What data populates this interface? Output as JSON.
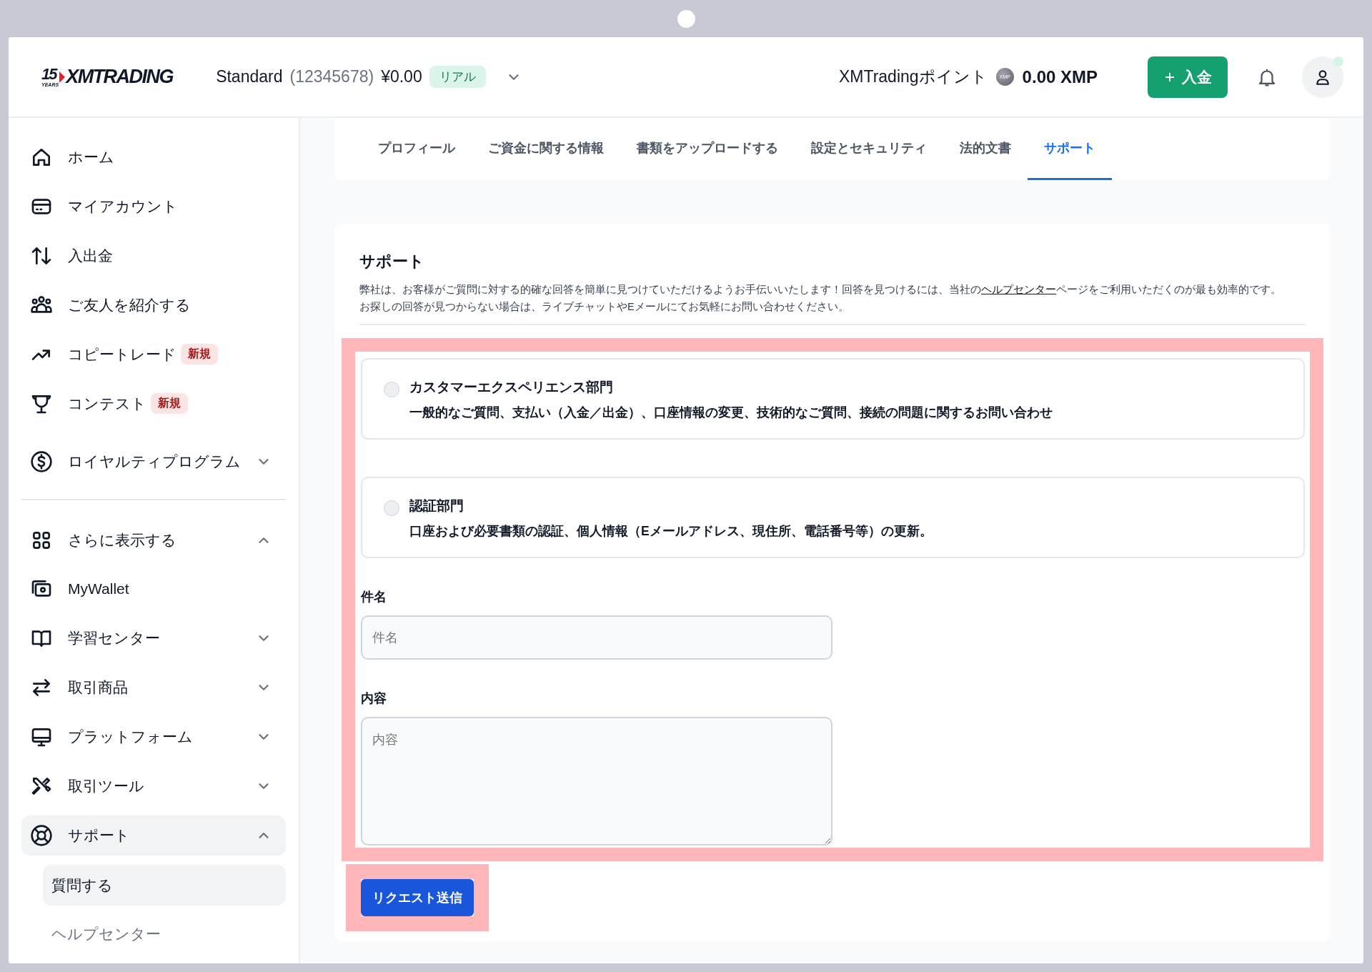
{
  "header": {
    "logo": {
      "years_number": "15",
      "years_word": "YEARS",
      "brand": "XMTRADING"
    },
    "account": {
      "type": "Standard",
      "number": "(12345678)",
      "balance": "¥0.00",
      "badge": "リアル"
    },
    "points": {
      "label": "XMTradingポイント",
      "coin_label": "XMP",
      "value": "0.00 XMP"
    },
    "deposit_button": "入金",
    "avatar": {
      "online": true
    }
  },
  "sidebar": {
    "primary": [
      {
        "label": "ホーム",
        "selected": false
      },
      {
        "label": "マイアカウント",
        "selected": false
      },
      {
        "label": "入出金",
        "selected": false
      },
      {
        "label": "ご友人を紹介する",
        "selected": false
      },
      {
        "label": "コピートレード",
        "badge": "新規",
        "selected": false
      },
      {
        "label": "コンテスト",
        "badge": "新規",
        "selected": false
      },
      {
        "label": "ロイヤルティプログラム",
        "expanded": false,
        "selected": false
      }
    ],
    "secondary": [
      {
        "label": "さらに表示する",
        "expanded": true,
        "selected": false
      },
      {
        "label": "MyWallet",
        "selected": false
      },
      {
        "label": "学習センター",
        "expanded": false,
        "selected": false
      },
      {
        "label": "取引商品",
        "expanded": false,
        "selected": false
      },
      {
        "label": "プラットフォーム",
        "expanded": false,
        "selected": false
      },
      {
        "label": "取引ツール",
        "expanded": false,
        "selected": false
      },
      {
        "label": "サポート",
        "expanded": true,
        "selected": true,
        "children": [
          {
            "label": "質問する",
            "selected": true
          },
          {
            "label": "ヘルプセンター",
            "selected": false
          }
        ]
      }
    ]
  },
  "tabs": [
    {
      "label": "プロフィール",
      "selected": false
    },
    {
      "label": "ご資金に関する情報",
      "selected": false
    },
    {
      "label": "書類をアップロードする",
      "selected": false
    },
    {
      "label": "設定とセキュリティ",
      "selected": false
    },
    {
      "label": "法的文書",
      "selected": false
    },
    {
      "label": "サポート",
      "selected": true
    }
  ],
  "support": {
    "title": "サポート",
    "description": {
      "before_link": "弊社は、お客様がご質問に対する的確な回答を簡単に見つけていただけるようお手伝いいたします！回答を見つけるには、当社の",
      "link": "ヘルプセンター",
      "after_link": "ページをご利用いただくのが最も効率的です。",
      "second_line": "お探しの回答が見つからない場合は、ライブチャットやEメールにてお気軽にお問い合わせください。"
    },
    "departments": [
      {
        "title": "カスタマーエクスペリエンス部門",
        "description": "一般的なご質問、支払い（入金／出金）、口座情報の変更、技術的なご質問、接続の問題に関するお問い合わせ",
        "selected": false
      },
      {
        "title": "認証部門",
        "description": "口座および必要書類の認証、個人情報（Eメールアドレス、現住所、電話番号等）の更新。",
        "selected": false
      }
    ],
    "subject": {
      "label": "件名",
      "placeholder": "件名"
    },
    "content": {
      "label": "内容",
      "placeholder": "内容"
    },
    "submit_button": "リクエスト送信"
  }
}
